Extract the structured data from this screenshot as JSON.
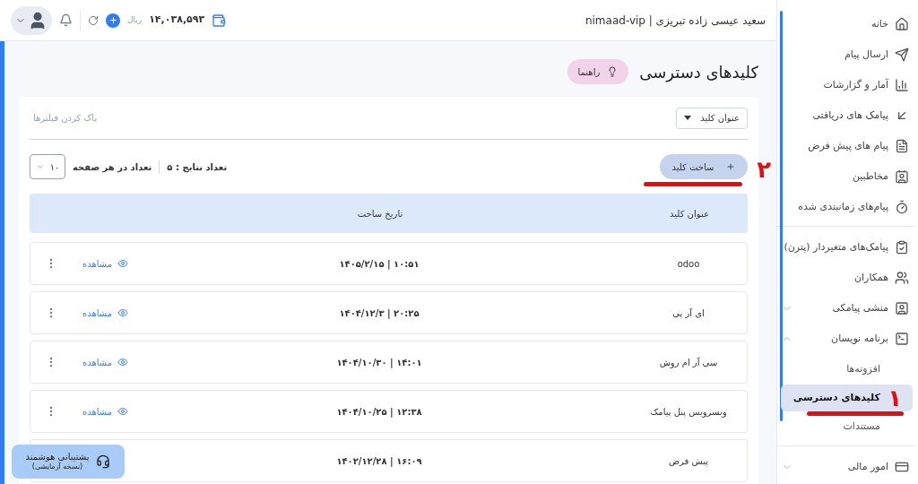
{
  "header": {
    "user": "سعید عیسی زاده تبریزی | nimaad-vip",
    "balance": "۱۴,۰۳۸,۵۹۳",
    "currency": "ریال"
  },
  "sidebar": {
    "groups": [
      [
        {
          "label": "خانه"
        },
        {
          "label": "ارسال پیام"
        },
        {
          "label": "آمار و گزارشات"
        },
        {
          "label": "پیامک های دریافتی"
        },
        {
          "label": "پیام های پیش فرض"
        },
        {
          "label": "مخاطبین"
        },
        {
          "label": "پیام‌های زمانبندی شده"
        }
      ],
      [
        {
          "label": "پیامک‌های متغیردار (پترن)"
        },
        {
          "label": "همکاران"
        },
        {
          "label": "منشی پیامکی",
          "expanded": false
        },
        {
          "label": "برنامه نویسان",
          "expanded": true,
          "children": [
            {
              "label": "افزونه‌ها",
              "selected": false
            },
            {
              "label": "کلیدهای دسترسی",
              "selected": true,
              "annotation": "۱"
            },
            {
              "label": "مستندات",
              "selected": false
            }
          ]
        }
      ],
      [
        {
          "label": "امور مالی",
          "expanded": false
        }
      ]
    ]
  },
  "page": {
    "title": "کلیدهای دسترسی",
    "guide_button": "راهنما"
  },
  "filters": {
    "key_title_filter": "عنوان کلید",
    "clear": "پاک کردن فیلترها"
  },
  "toolbar": {
    "create_button": "ساخت کلید",
    "create_annotation": "۲",
    "results": "تعداد نتایج : ۵",
    "per_page_label": "تعداد در هر صفحه",
    "per_page": "۱۰"
  },
  "table": {
    "columns": [
      "عنوان کلید",
      "تاریخ ساخت"
    ],
    "rows": [
      {
        "title": "odoo",
        "date": "۱۰:۵۱ | ۱۴۰۵/۲/۱۵",
        "view": "مشاهده"
      },
      {
        "title": "ای آر پی",
        "date": "۲۰:۲۵ | ۱۴۰۴/۱۲/۳",
        "view": "مشاهده"
      },
      {
        "title": "سی آر ام روش",
        "date": "۱۴:۰۱ | ۱۴۰۴/۱۰/۳۰",
        "view": "مشاهده"
      },
      {
        "title": "وبسرویس پنل پیامک",
        "date": "۱۲:۳۸ | ۱۴۰۴/۱۰/۲۵",
        "view": "مشاهده"
      },
      {
        "title": "پیش فرض",
        "date": "۱۶:۰۹ | ۱۴۰۲/۱۲/۲۸"
      }
    ]
  },
  "support": {
    "title": "پشتیبانی هوشمند",
    "subtitle": "(نسخه آزمایشی)"
  }
}
